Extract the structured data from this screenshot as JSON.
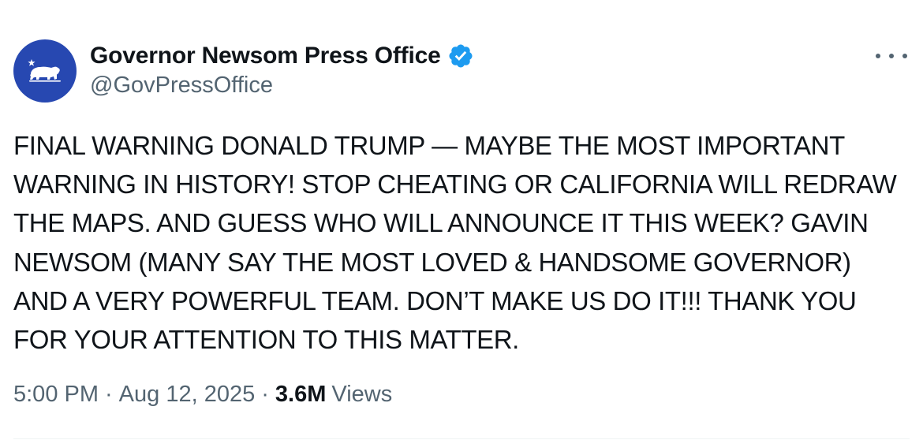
{
  "account": {
    "display_name": "Governor Newsom Press Office",
    "handle": "@GovPressOffice",
    "verified": true,
    "avatar_color": "#2748b1",
    "badge_color": "#1d9bf0"
  },
  "icons": {
    "avatar": "california-bear-icon",
    "verified": "verified-badge-icon",
    "more": "more-dots-icon"
  },
  "tweet": {
    "text_lines": [
      "FINAL WARNING DONALD TRUMP — MAYBE THE MOST IMPORTANT",
      "WARNING IN HISTORY! STOP CHEATING OR CALIFORNIA WILL REDRAW",
      "THE MAPS. AND GUESS WHO WILL ANNOUNCE IT THIS WEEK? GAVIN",
      "NEWSOM (MANY SAY THE MOST LOVED & HANDSOME GOVERNOR)",
      "AND A VERY POWERFUL TEAM. DON’T MAKE US DO IT!!! THANK YOU",
      "FOR YOUR ATTENTION TO THIS MATTER."
    ]
  },
  "meta": {
    "time": "5:00 PM",
    "date": "Aug 12, 2025",
    "separator": "·",
    "views_count": "3.6M",
    "views_label": "Views"
  }
}
